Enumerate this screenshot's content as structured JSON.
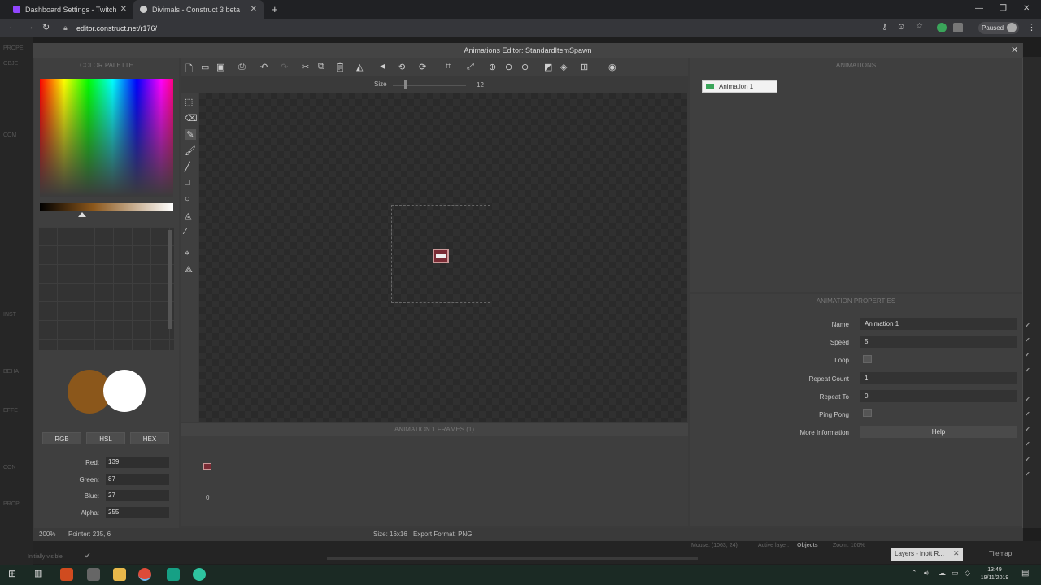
{
  "browser": {
    "tabs": [
      {
        "title": "Dashboard Settings - Twitch",
        "favicon_color": "#9146ff"
      },
      {
        "title": "Divimals - Construct 3 beta",
        "favicon_color": "#cccccc"
      }
    ],
    "url": "editor.construct.net/r176/",
    "profile_label": "Paused"
  },
  "editor": {
    "left_labels": [
      "PROPE",
      "OBJE",
      "COM",
      "INST",
      "BEHA",
      "EFFE",
      "CON",
      "PROP"
    ],
    "bottom_left": "Initially visible",
    "bottom_info": {
      "mouse": "Mouse: (1063, 24)",
      "active_layer_label": "Active layer:",
      "active_layer": "Objects",
      "zoom": "Zoom: 100%"
    },
    "layers_tab": "Layers - inott R...",
    "tilemap_tab": "Tilemap"
  },
  "dialog": {
    "title": "Animations Editor: StandardItemSpawn",
    "color_palette": {
      "header": "COLOR PALETTE",
      "primary_color": "#8b571b",
      "secondary_color": "#ffffff",
      "modes": [
        "RGB",
        "HSL",
        "HEX"
      ],
      "fields": [
        {
          "label": "Red:",
          "value": "139"
        },
        {
          "label": "Green:",
          "value": "87"
        },
        {
          "label": "Blue:",
          "value": "27"
        },
        {
          "label": "Alpha:",
          "value": "255"
        }
      ]
    },
    "toolbar": {
      "size_label": "Size",
      "size_value": "12"
    },
    "frames": {
      "header": "ANIMATION 1 FRAMES (1)",
      "frame_index": "0"
    },
    "animations": {
      "header": "ANIMATIONS",
      "items": [
        "Animation 1"
      ]
    },
    "properties": {
      "header": "ANIMATION PROPERTIES",
      "name_label": "Name",
      "name_value": "Animation 1",
      "speed_label": "Speed",
      "speed_value": "5",
      "loop_label": "Loop",
      "repeat_count_label": "Repeat Count",
      "repeat_count_value": "1",
      "repeat_to_label": "Repeat To",
      "repeat_to_value": "0",
      "ping_pong_label": "Ping Pong",
      "more_info_label": "More Information",
      "help_label": "Help"
    },
    "status": {
      "zoom": "200%",
      "pointer": "Pointer: 235, 6",
      "size": "Size: 16x16",
      "export_format": "Export Format: PNG"
    }
  },
  "taskbar": {
    "time": "13:49",
    "date": "19/11/2019"
  }
}
